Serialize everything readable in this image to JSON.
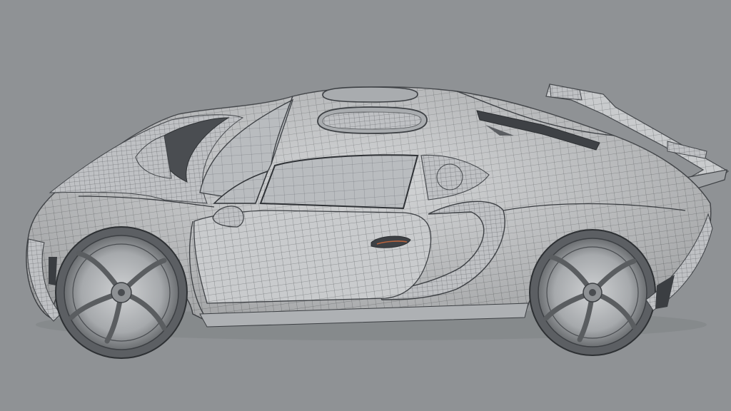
{
  "scene": {
    "background_color": "#8f9295",
    "subject": "sports-car-wireframe-model",
    "body_color": "#c9cbcd",
    "wire_color": "#55585b",
    "glass_color": "#b8bbbe",
    "dark_trim_color": "#3d4044",
    "accent_color": "#b8633e"
  }
}
